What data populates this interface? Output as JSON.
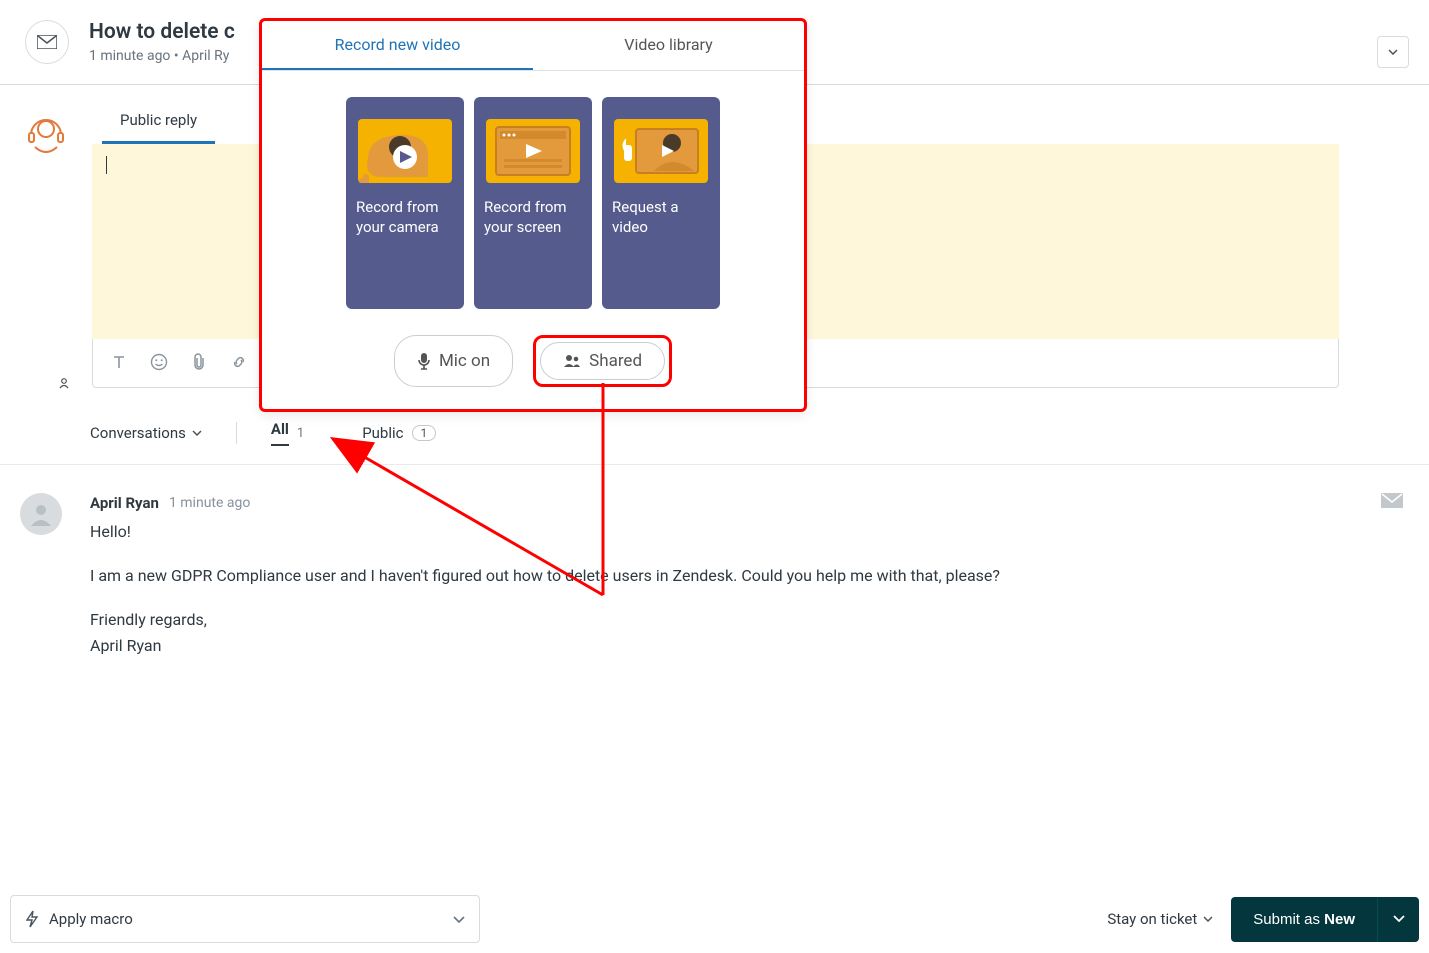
{
  "header": {
    "title": "How to delete c",
    "meta": "1 minute ago • April Ry"
  },
  "reply": {
    "tab_public": "Public reply"
  },
  "conversations": {
    "label": "Conversations",
    "filters": {
      "all_label": "All",
      "all_count": "1",
      "public_label": "Public",
      "public_count": "1"
    }
  },
  "message": {
    "author": "April Ryan",
    "time": "1 minute ago",
    "body_greeting": "Hello!",
    "body_main": "I am a new GDPR Compliance user and I haven't figured out how to delete users in Zendesk. Could you help me with that, please?",
    "body_sign1": "Friendly regards,",
    "body_sign2": "April Ryan"
  },
  "bottom": {
    "macro": "Apply macro",
    "stay": "Stay on ticket",
    "submit_prefix": "Submit as ",
    "submit_status": "New"
  },
  "video_popover": {
    "tab_record": "Record new video",
    "tab_library": "Video library",
    "card1": "Record from your camera",
    "card2": "Record from your screen",
    "card3": "Request a video",
    "mic": "Mic on",
    "shared": "Shared"
  }
}
